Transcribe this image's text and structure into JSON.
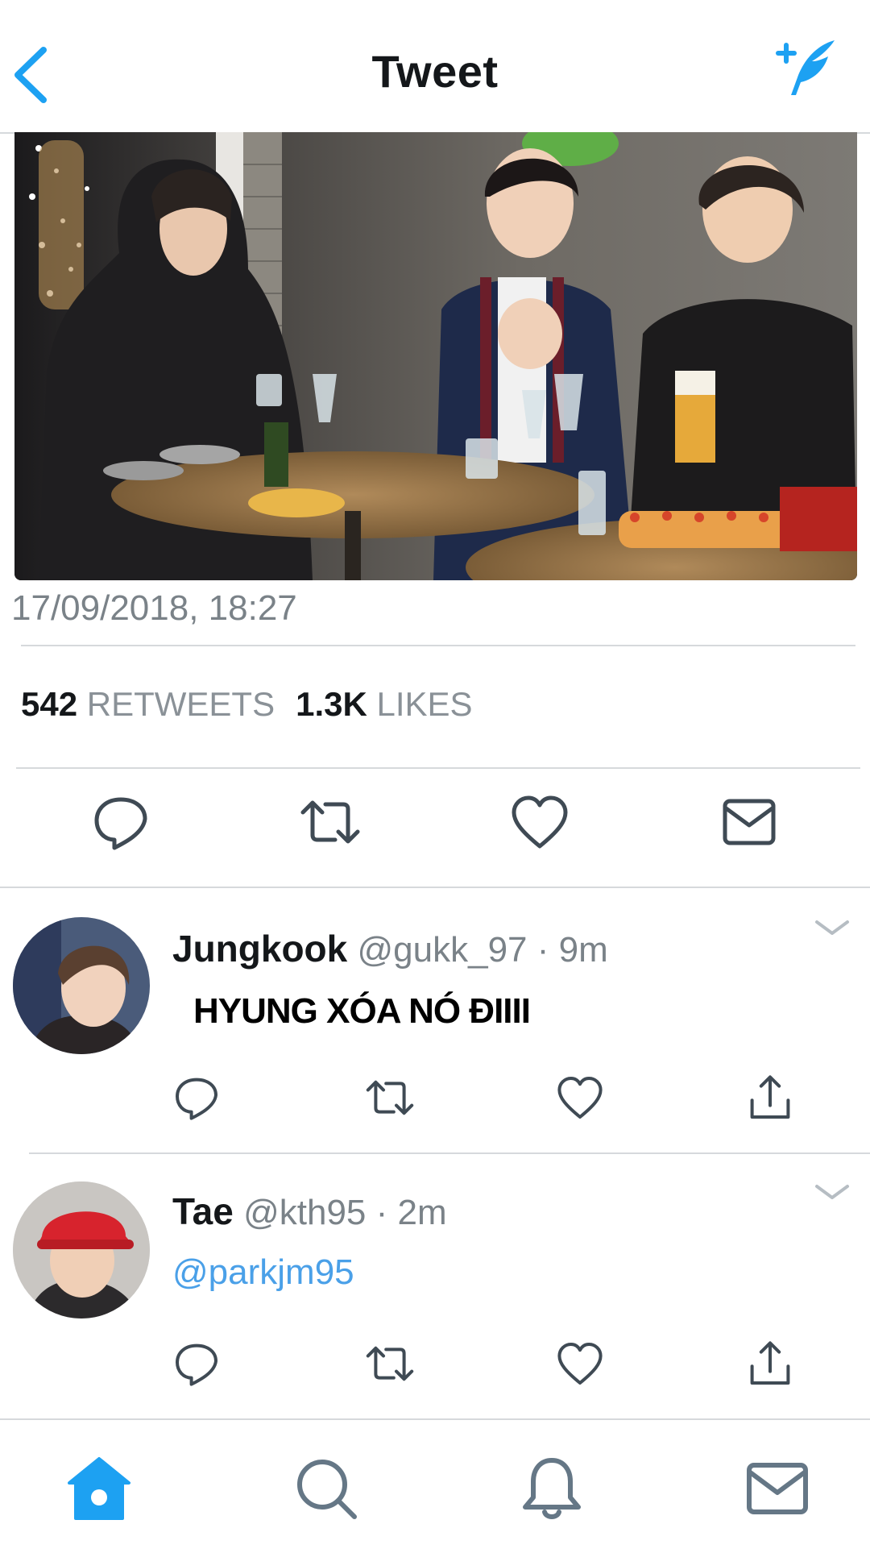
{
  "header": {
    "title": "Tweet",
    "back_icon": "chevron-left-icon",
    "compose_icon": "compose-feather-icon"
  },
  "tweet": {
    "timestamp": "17/09/2018, 18:27",
    "retweets_count": "542",
    "retweets_label": "RETWEETS",
    "likes_count": "1.3K",
    "likes_label": "LIKES",
    "actions": [
      "reply-icon",
      "retweet-icon",
      "like-icon",
      "message-icon"
    ]
  },
  "replies": [
    {
      "name": "Jungkook",
      "handle": "@gukk_97",
      "separator": "·",
      "time": "9m",
      "text": "HYUNG XÓA NÓ ĐIIII"
    },
    {
      "name": "Tae",
      "handle": "@kth95",
      "separator": "·",
      "time": "2m",
      "text": "@parkjm95"
    }
  ],
  "tabbar": {
    "tabs": [
      "home-icon",
      "search-icon",
      "notifications-icon",
      "messages-icon"
    ],
    "active": "home-icon"
  },
  "colors": {
    "accent": "#1da1f2",
    "icon_gray": "#657786",
    "text_secondary": "#7a8288",
    "divider": "#d6d9dc",
    "mention": "#4aa0e8"
  }
}
